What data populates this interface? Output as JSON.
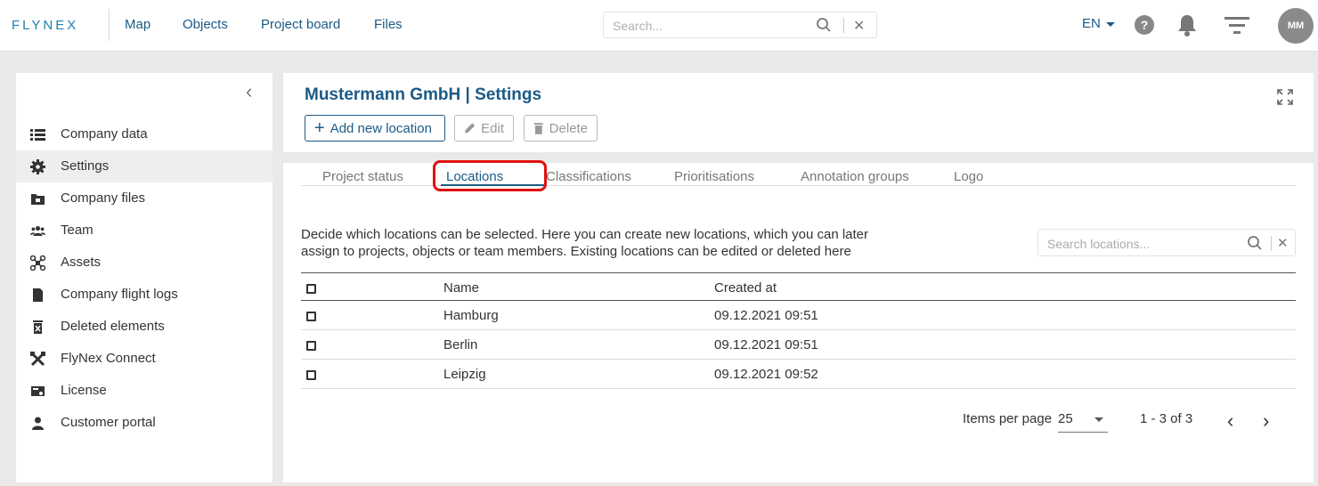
{
  "topbar": {
    "logo": "FLYNEX",
    "nav": [
      "Map",
      "Objects",
      "Project board",
      "Files"
    ],
    "search_placeholder": "Search...",
    "lang": "EN",
    "avatar": "MM"
  },
  "sidebar": {
    "items": [
      {
        "label": "Company data",
        "icon": "list-icon"
      },
      {
        "label": "Settings",
        "icon": "gear-icon",
        "active": true
      },
      {
        "label": "Company files",
        "icon": "folder-icon"
      },
      {
        "label": "Team",
        "icon": "people-icon"
      },
      {
        "label": "Assets",
        "icon": "drone-icon"
      },
      {
        "label": "Company flight logs",
        "icon": "document-icon"
      },
      {
        "label": "Deleted elements",
        "icon": "trash-icon"
      },
      {
        "label": "FlyNex Connect",
        "icon": "tools-icon"
      },
      {
        "label": "License",
        "icon": "license-icon"
      },
      {
        "label": "Customer portal",
        "icon": "person-icon"
      }
    ]
  },
  "header": {
    "title": "Mustermann GmbH | Settings",
    "add_label": "Add new location",
    "edit_label": "Edit",
    "delete_label": "Delete"
  },
  "tabs": [
    "Project status",
    "Locations",
    "Classifications",
    "Prioritisations",
    "Annotation groups",
    "Logo"
  ],
  "content": {
    "description": "Decide which locations can be selected. Here you can create new locations, which you can later assign to projects, objects or team members. Existing locations can be edited or deleted here",
    "search_placeholder": "Search locations...",
    "columns": {
      "name": "Name",
      "created": "Created at"
    },
    "rows": [
      {
        "name": "Hamburg",
        "created": "09.12.2021 09:51"
      },
      {
        "name": "Berlin",
        "created": "09.12.2021 09:51"
      },
      {
        "name": "Leipzig",
        "created": "09.12.2021 09:52"
      }
    ],
    "pager": {
      "items_label": "Items per page",
      "per_page": "25",
      "range": "1 - 3 of 3"
    }
  },
  "colors": {
    "accent": "#1b5a86",
    "highlight": "#e01010"
  }
}
